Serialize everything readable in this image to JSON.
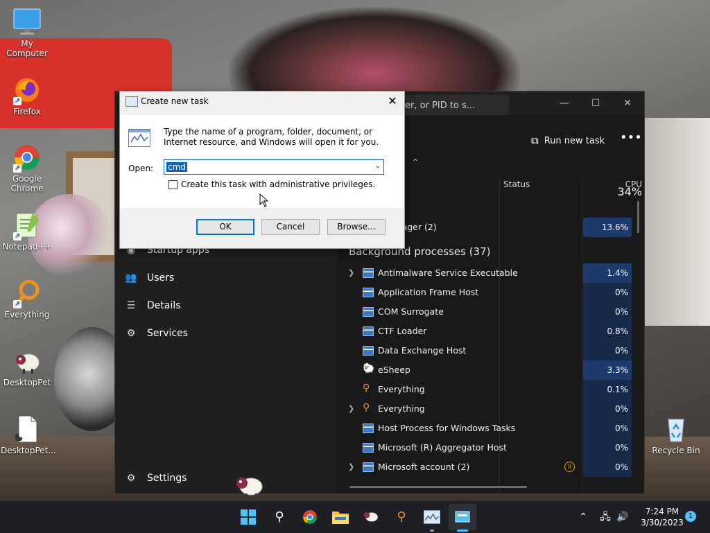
{
  "desktop": {
    "icons": [
      {
        "label": "My Computer",
        "icon": "monitor-icon"
      },
      {
        "label": "Firefox",
        "icon": "firefox-icon"
      },
      {
        "label": "Google Chrome",
        "icon": "chrome-icon"
      },
      {
        "label": "Notepad++",
        "icon": "notepadpp-icon"
      },
      {
        "label": "Everything",
        "icon": "everything-icon"
      },
      {
        "label": "DesktopPet",
        "icon": "sheep-icon"
      },
      {
        "label": "DesktopPet...",
        "icon": "file-shortcut-icon"
      },
      {
        "label": "Recycle Bin",
        "icon": "recycle-bin-icon"
      }
    ]
  },
  "task_manager": {
    "search_placeholder": "er, or PID to s...",
    "run_new_task": "Run new task",
    "nav": {
      "startup_apps": "Startup apps",
      "users": "Users",
      "details": "Details",
      "services": "Services",
      "settings": "Settings"
    },
    "columns": {
      "status": "Status",
      "cpu": "CPU",
      "cpu_total": "34%"
    },
    "top_row": {
      "name": "anager (2)",
      "cpu": "13.6%"
    },
    "background_title": "Background processes (37)",
    "processes": [
      {
        "name": "Antimalware Service Executable",
        "cpu": "1.4%",
        "expandable": true
      },
      {
        "name": "Application Frame Host",
        "cpu": "0%",
        "expandable": false
      },
      {
        "name": "COM Surrogate",
        "cpu": "0%",
        "expandable": false
      },
      {
        "name": "CTF Loader",
        "cpu": "0.8%",
        "expandable": false
      },
      {
        "name": "Data Exchange Host",
        "cpu": "0%",
        "expandable": false
      },
      {
        "name": "eSheep",
        "cpu": "3.3%",
        "expandable": false
      },
      {
        "name": "Everything",
        "cpu": "0.1%",
        "expandable": false
      },
      {
        "name": "Everything",
        "cpu": "0%",
        "expandable": true
      },
      {
        "name": "Host Process for Windows Tasks",
        "cpu": "0%",
        "expandable": false
      },
      {
        "name": "Microsoft (R) Aggregator Host",
        "cpu": "0%",
        "expandable": false
      },
      {
        "name": "Microsoft account (2)",
        "cpu": "0%",
        "expandable": true
      }
    ]
  },
  "dialog": {
    "title": "Create new task",
    "description": "Type the name of a program, folder, document, or Internet resource, and Windows will open it for you.",
    "open_label": "Open:",
    "open_value": "cmd",
    "admin_checkbox": "Create this task with administrative privileges.",
    "ok": "OK",
    "cancel": "Cancel",
    "browse": "Browse..."
  },
  "taskbar": {
    "time": "7:24 PM",
    "date": "3/30/2023",
    "notifications": "1"
  }
}
